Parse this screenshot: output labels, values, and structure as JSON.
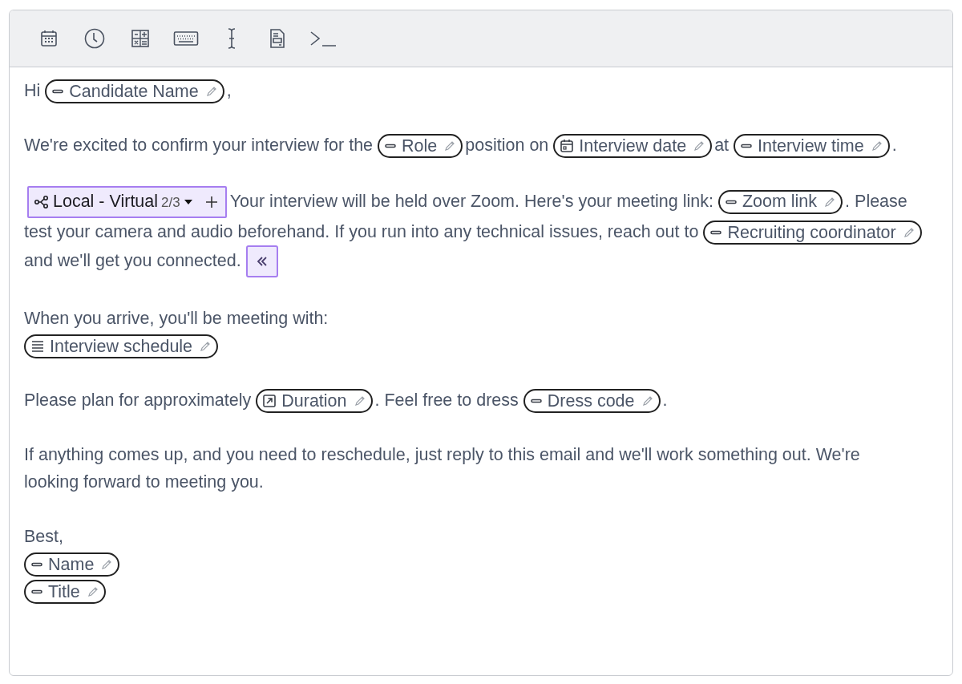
{
  "paragraphs": [
    {
      "lines": [
        [
          {
            "kind": "text",
            "text": "Hi"
          },
          {
            "kind": "field",
            "label": "Candidate Name"
          },
          {
            "kind": "text",
            "text": ","
          }
        ]
      ]
    },
    {
      "lines": [
        [
          {
            "kind": "text",
            "text": "We're excited to confirm your interview for the"
          },
          {
            "kind": "field",
            "label": "Role"
          },
          {
            "kind": "text",
            "text": "position on"
          },
          {
            "kind": "datefield",
            "label": "Interview date"
          },
          {
            "kind": "text",
            "text": "at"
          },
          {
            "kind": "field",
            "label": "Interview time"
          },
          {
            "kind": "text",
            "text": "."
          }
        ]
      ]
    },
    {
      "lines": [
        [
          {
            "kind": "variant",
            "label": "Local - Virtual",
            "counter": "2/3"
          },
          {
            "kind": "text",
            "text": "Your interview will be held over Zoom. Here's your meeting link:"
          },
          {
            "kind": "field",
            "label": "Zoom link"
          },
          {
            "kind": "text",
            "text": ". Please"
          },
          {
            "kind": "text",
            "text": "test your camera and audio beforehand. If you run into any technical issues, reach out to"
          },
          {
            "kind": "field",
            "label": "Recruiting coordinator"
          },
          {
            "kind": "text",
            "text": "and we'll get you connected."
          },
          {
            "kind": "collapse"
          }
        ]
      ]
    },
    {
      "lines": [
        [
          {
            "kind": "text",
            "text": "When you arrive, you'll be meeting with:"
          }
        ],
        [
          {
            "kind": "listfield",
            "label": "Interview schedule"
          }
        ]
      ]
    },
    {
      "lines": [
        [
          {
            "kind": "text",
            "text": "Please plan for approximately"
          },
          {
            "kind": "durationfield",
            "label": "Duration"
          },
          {
            "kind": "text",
            "text": ". Feel free to dress"
          },
          {
            "kind": "field",
            "label": "Dress code"
          },
          {
            "kind": "text",
            "text": "."
          }
        ]
      ]
    },
    {
      "lines": [
        [
          {
            "kind": "text",
            "text": "If anything comes up, and you need to reschedule, just reply to this email and we'll work something out. We're"
          },
          {
            "kind": "text",
            "text": "looking forward to meeting you."
          }
        ]
      ]
    },
    {
      "lines": [
        [
          {
            "kind": "text",
            "text": "Best,"
          }
        ],
        [
          {
            "kind": "field",
            "label": "Name"
          }
        ],
        [
          {
            "kind": "field",
            "label": "Title"
          }
        ]
      ]
    }
  ]
}
